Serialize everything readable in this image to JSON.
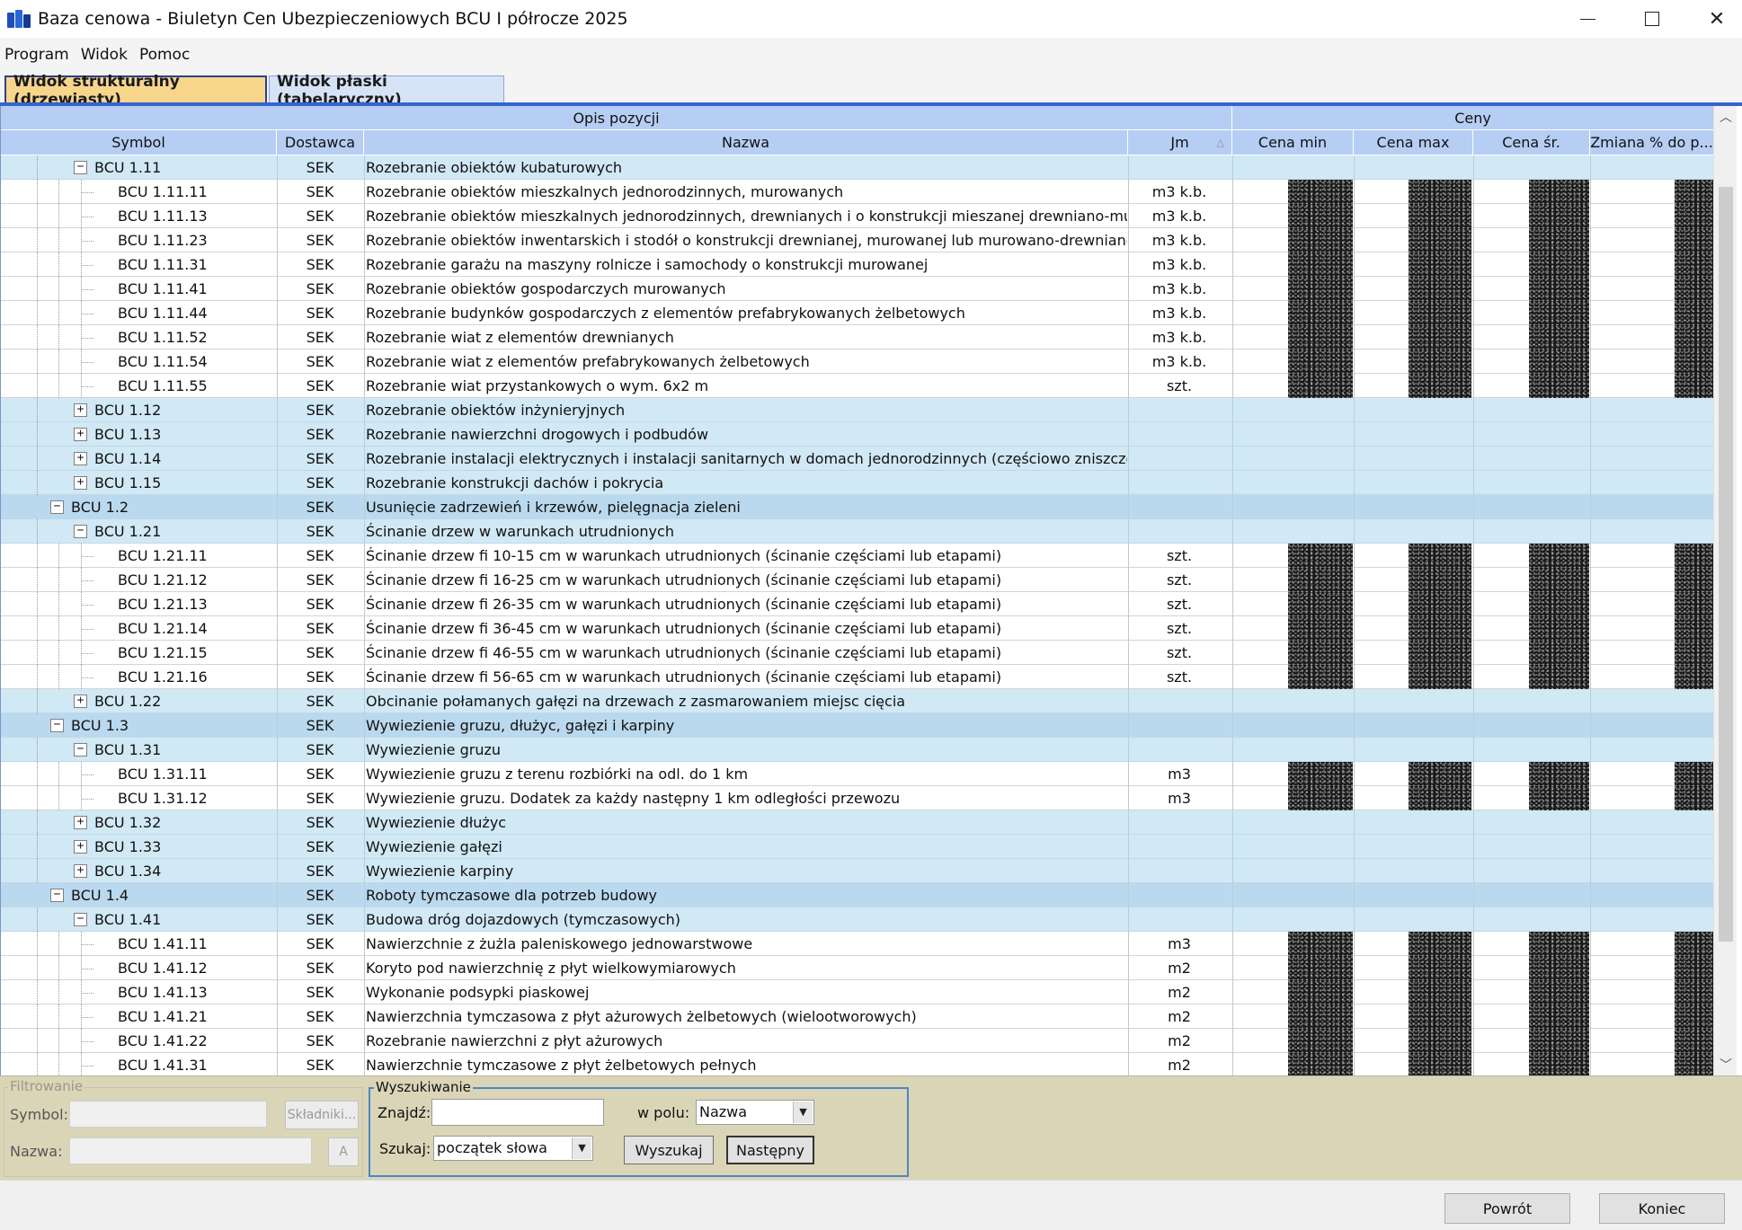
{
  "window": {
    "title": "Baza cenowa - Biuletyn Cen Ubezpieczeniowych BCU I półrocze 2025",
    "controls": {
      "minimize": "—",
      "close": "✕"
    }
  },
  "menu": [
    "Program",
    "Widok",
    "Pomoc"
  ],
  "tabs": [
    {
      "label": "Widok strukturalny (drzewiasty)",
      "active": true
    },
    {
      "label": "Widok płaski (tabelaryczny)",
      "active": false
    }
  ],
  "grid": {
    "group_headers": {
      "opis": "Opis pozycji",
      "ceny": "Ceny"
    },
    "columns": {
      "symbol": "Symbol",
      "dostawca": "Dostawca",
      "nazwa": "Nazwa",
      "jm": "Jm",
      "cena_min": "Cena min",
      "cena_max": "Cena max",
      "cena_sr": "Cena śr.",
      "zmiana": "Zmiana % do p..."
    },
    "sorted_column": "jm",
    "rows": [
      {
        "level": 2,
        "type": "group",
        "exp": "-",
        "symbol": "BCU 1.11",
        "dostawca": "SEK",
        "nazwa": "Rozebranie obiektów kubaturowych",
        "jm": ""
      },
      {
        "level": 3,
        "type": "item",
        "symbol": "BCU 1.11.11",
        "dostawca": "SEK",
        "nazwa": "Rozebranie obiektów mieszkalnych jednorodzinnych, murowanych",
        "jm": "m3 k.b."
      },
      {
        "level": 3,
        "type": "item",
        "symbol": "BCU 1.11.13",
        "dostawca": "SEK",
        "nazwa": "Rozebranie obiektów mieszkalnych jednorodzinnych, drewnianych i o konstrukcji mieszanej drewniano-murowanej",
        "jm": "m3 k.b."
      },
      {
        "level": 3,
        "type": "item",
        "symbol": "BCU 1.11.23",
        "dostawca": "SEK",
        "nazwa": "Rozebranie obiektów inwentarskich i stodół o konstrukcji drewnianej, murowanej lub murowano-drewnianej",
        "jm": "m3 k.b."
      },
      {
        "level": 3,
        "type": "item",
        "symbol": "BCU 1.11.31",
        "dostawca": "SEK",
        "nazwa": "Rozebranie garażu na maszyny rolnicze i samochody o konstrukcji murowanej",
        "jm": "m3 k.b."
      },
      {
        "level": 3,
        "type": "item",
        "symbol": "BCU 1.11.41",
        "dostawca": "SEK",
        "nazwa": "Rozebranie obiektów gospodarczych murowanych",
        "jm": "m3 k.b."
      },
      {
        "level": 3,
        "type": "item",
        "symbol": "BCU 1.11.44",
        "dostawca": "SEK",
        "nazwa": "Rozebranie budynków gospodarczych z elementów prefabrykowanych żelbetowych",
        "jm": "m3 k.b."
      },
      {
        "level": 3,
        "type": "item",
        "symbol": "BCU 1.11.52",
        "dostawca": "SEK",
        "nazwa": "Rozebranie wiat z elementów drewnianych",
        "jm": "m3 k.b."
      },
      {
        "level": 3,
        "type": "item",
        "symbol": "BCU 1.11.54",
        "dostawca": "SEK",
        "nazwa": "Rozebranie wiat z elementów prefabrykowanych żelbetowych",
        "jm": "m3 k.b."
      },
      {
        "level": 3,
        "type": "item",
        "symbol": "BCU 1.11.55",
        "dostawca": "SEK",
        "nazwa": "Rozebranie wiat przystankowych o wym. 6x2 m",
        "jm": "szt."
      },
      {
        "level": 2,
        "type": "group",
        "exp": "+",
        "symbol": "BCU 1.12",
        "dostawca": "SEK",
        "nazwa": "Rozebranie obiektów inżynieryjnych",
        "jm": ""
      },
      {
        "level": 2,
        "type": "group",
        "exp": "+",
        "symbol": "BCU 1.13",
        "dostawca": "SEK",
        "nazwa": "Rozebranie nawierzchni drogowych i podbudów",
        "jm": ""
      },
      {
        "level": 2,
        "type": "group",
        "exp": "+",
        "symbol": "BCU 1.14",
        "dostawca": "SEK",
        "nazwa": "Rozebranie instalacji elektrycznych i instalacji sanitarnych w domach jednorodzinnych (częściowo zniszczonych)",
        "jm": ""
      },
      {
        "level": 2,
        "type": "group",
        "exp": "+",
        "symbol": "BCU 1.15",
        "dostawca": "SEK",
        "nazwa": "Rozebranie konstrukcji dachów i pokrycia",
        "jm": ""
      },
      {
        "level": 1,
        "type": "group",
        "exp": "-",
        "symbol": "BCU 1.2",
        "dostawca": "SEK",
        "nazwa": "Usunięcie zadrzewień i krzewów, pielęgnacja zieleni",
        "jm": ""
      },
      {
        "level": 2,
        "type": "group",
        "exp": "-",
        "symbol": "BCU 1.21",
        "dostawca": "SEK",
        "nazwa": "Ścinanie drzew w warunkach utrudnionych",
        "jm": ""
      },
      {
        "level": 3,
        "type": "item",
        "symbol": "BCU 1.21.11",
        "dostawca": "SEK",
        "nazwa": "Ścinanie drzew fi 10-15 cm w warunkach utrudnionych (ścinanie częściami lub etapami)",
        "jm": "szt."
      },
      {
        "level": 3,
        "type": "item",
        "symbol": "BCU 1.21.12",
        "dostawca": "SEK",
        "nazwa": "Ścinanie drzew fi 16-25 cm w warunkach utrudnionych (ścinanie częściami lub etapami)",
        "jm": "szt."
      },
      {
        "level": 3,
        "type": "item",
        "symbol": "BCU 1.21.13",
        "dostawca": "SEK",
        "nazwa": "Ścinanie drzew fi 26-35 cm w warunkach utrudnionych (ścinanie częściami lub etapami)",
        "jm": "szt."
      },
      {
        "level": 3,
        "type": "item",
        "symbol": "BCU 1.21.14",
        "dostawca": "SEK",
        "nazwa": "Ścinanie drzew fi 36-45 cm w warunkach utrudnionych (ścinanie częściami lub etapami)",
        "jm": "szt."
      },
      {
        "level": 3,
        "type": "item",
        "symbol": "BCU 1.21.15",
        "dostawca": "SEK",
        "nazwa": "Ścinanie drzew fi 46-55 cm w warunkach utrudnionych (ścinanie częściami lub etapami)",
        "jm": "szt."
      },
      {
        "level": 3,
        "type": "item",
        "symbol": "BCU 1.21.16",
        "dostawca": "SEK",
        "nazwa": "Ścinanie drzew fi 56-65 cm w warunkach utrudnionych (ścinanie częściami lub etapami)",
        "jm": "szt."
      },
      {
        "level": 2,
        "type": "group",
        "exp": "+",
        "symbol": "BCU 1.22",
        "dostawca": "SEK",
        "nazwa": "Obcinanie połamanych gałęzi na drzewach z zasmarowaniem miejsc cięcia",
        "jm": ""
      },
      {
        "level": 1,
        "type": "group",
        "exp": "-",
        "symbol": "BCU 1.3",
        "dostawca": "SEK",
        "nazwa": "Wywiezienie gruzu, dłużyc, gałęzi i karpiny",
        "jm": ""
      },
      {
        "level": 2,
        "type": "group",
        "exp": "-",
        "symbol": "BCU 1.31",
        "dostawca": "SEK",
        "nazwa": "Wywiezienie gruzu",
        "jm": ""
      },
      {
        "level": 3,
        "type": "item",
        "symbol": "BCU 1.31.11",
        "dostawca": "SEK",
        "nazwa": "Wywiezienie gruzu z terenu rozbiórki na odl. do 1 km",
        "jm": "m3"
      },
      {
        "level": 3,
        "type": "item",
        "symbol": "BCU 1.31.12",
        "dostawca": "SEK",
        "nazwa": "Wywiezienie gruzu. Dodatek za każdy następny 1 km odległości przewozu",
        "jm": "m3"
      },
      {
        "level": 2,
        "type": "group",
        "exp": "+",
        "symbol": "BCU 1.32",
        "dostawca": "SEK",
        "nazwa": "Wywiezienie dłużyc",
        "jm": ""
      },
      {
        "level": 2,
        "type": "group",
        "exp": "+",
        "symbol": "BCU 1.33",
        "dostawca": "SEK",
        "nazwa": "Wywiezienie gałęzi",
        "jm": ""
      },
      {
        "level": 2,
        "type": "group",
        "exp": "+",
        "symbol": "BCU 1.34",
        "dostawca": "SEK",
        "nazwa": "Wywiezienie karpiny",
        "jm": ""
      },
      {
        "level": 1,
        "type": "group",
        "exp": "-",
        "symbol": "BCU 1.4",
        "dostawca": "SEK",
        "nazwa": "Roboty tymczasowe dla potrzeb budowy",
        "jm": ""
      },
      {
        "level": 2,
        "type": "group",
        "exp": "-",
        "symbol": "BCU 1.41",
        "dostawca": "SEK",
        "nazwa": "Budowa dróg dojazdowych (tymczasowych)",
        "jm": ""
      },
      {
        "level": 3,
        "type": "item",
        "symbol": "BCU 1.41.11",
        "dostawca": "SEK",
        "nazwa": "Nawierzchnie z żużla paleniskowego jednowarstwowe",
        "jm": "m3"
      },
      {
        "level": 3,
        "type": "item",
        "symbol": "BCU 1.41.12",
        "dostawca": "SEK",
        "nazwa": "Koryto pod nawierzchnię z płyt wielkowymiarowych",
        "jm": "m2"
      },
      {
        "level": 3,
        "type": "item",
        "symbol": "BCU 1.41.13",
        "dostawca": "SEK",
        "nazwa": "Wykonanie podsypki piaskowej",
        "jm": "m2"
      },
      {
        "level": 3,
        "type": "item",
        "symbol": "BCU 1.41.21",
        "dostawca": "SEK",
        "nazwa": "Nawierzchnia tymczasowa z płyt ażurowych żelbetowych (wielootworowych)",
        "jm": "m2"
      },
      {
        "level": 3,
        "type": "item",
        "symbol": "BCU 1.41.22",
        "dostawca": "SEK",
        "nazwa": "Rozebranie nawierzchni z płyt ażurowych",
        "jm": "m2"
      },
      {
        "level": 3,
        "type": "item",
        "symbol": "BCU 1.41.31",
        "dostawca": "SEK",
        "nazwa": "Nawierzchnie tymczasowe z płyt żelbetowych pełnych",
        "jm": "m2"
      }
    ]
  },
  "filter": {
    "legend": "Filtrowanie",
    "symbol_label": "Symbol:",
    "nazwa_label": "Nazwa:",
    "skladniki_button": "Składniki...",
    "small_button": "A",
    "symbol_value": "",
    "nazwa_value": ""
  },
  "search": {
    "legend": "Wyszukiwanie",
    "znajdz_label": "Znajdź:",
    "znajdz_value": "",
    "wpolu_label": "w polu:",
    "wpolu_value": "Nazwa",
    "szukaj_label": "Szukaj:",
    "szukaj_value": "początek słowa",
    "wyszukaj_button": "Wyszukaj",
    "nastepny_button": "Następny"
  },
  "footer": {
    "powrot": "Powrót",
    "koniec": "Koniec"
  }
}
